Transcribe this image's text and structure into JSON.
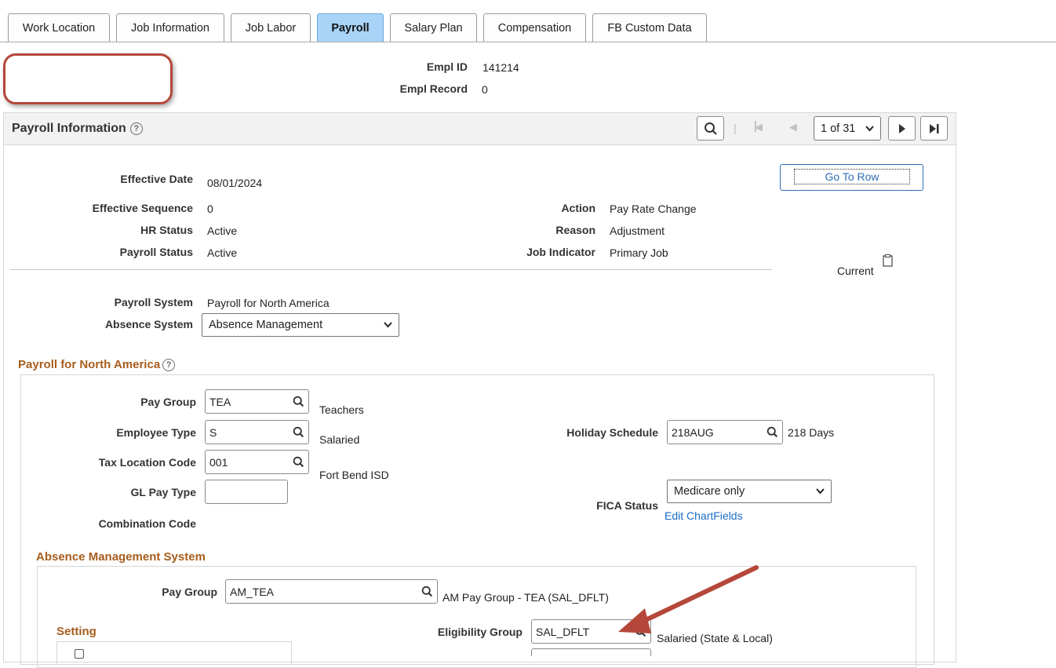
{
  "tabs": [
    {
      "label": "Work Location"
    },
    {
      "label": "Job Information"
    },
    {
      "label": "Job Labor"
    },
    {
      "label": "Payroll"
    },
    {
      "label": "Salary Plan"
    },
    {
      "label": "Compensation"
    },
    {
      "label": "FB Custom Data"
    }
  ],
  "active_tab": "Payroll",
  "employee": {
    "empl_id_label": "Empl ID",
    "empl_id": "141214",
    "empl_record_label": "Empl Record",
    "empl_record": "0"
  },
  "payroll_info": {
    "title": "Payroll Information",
    "pager": "1 of 31",
    "go_to_row": "Go To Row",
    "effective_date_label": "Effective Date",
    "effective_date": "08/01/2024",
    "effective_sequence_label": "Effective Sequence",
    "effective_sequence": "0",
    "hr_status_label": "HR Status",
    "hr_status": "Active",
    "payroll_status_label": "Payroll Status",
    "payroll_status": "Active",
    "action_label": "Action",
    "action": "Pay Rate Change",
    "reason_label": "Reason",
    "reason": "Adjustment",
    "job_indicator_label": "Job Indicator",
    "job_indicator": "Primary Job",
    "current_label": "Current",
    "payroll_system_label": "Payroll System",
    "payroll_system": "Payroll for North America",
    "absence_system_label": "Absence System",
    "absence_system": "Absence Management"
  },
  "pna": {
    "title": "Payroll for North America",
    "pay_group_label": "Pay Group",
    "pay_group": "TEA",
    "pay_group_desc": "Teachers",
    "employee_type_label": "Employee Type",
    "employee_type": "S",
    "employee_type_desc": "Salaried",
    "tax_location_label": "Tax Location Code",
    "tax_location": "001",
    "tax_location_desc": "Fort Bend ISD",
    "gl_pay_type_label": "GL Pay Type",
    "gl_pay_type": "",
    "combination_code_label": "Combination Code",
    "holiday_schedule_label": "Holiday Schedule",
    "holiday_schedule": "218AUG",
    "holiday_schedule_desc": "218 Days",
    "fica_status_label": "FICA Status",
    "fica_status": "Medicare only",
    "edit_chartfields": "Edit ChartFields"
  },
  "ams": {
    "title": "Absence Management System",
    "pay_group_label": "Pay Group",
    "pay_group": "AM_TEA",
    "pay_group_desc": "AM Pay Group - TEA (SAL_DFLT)",
    "setting_title": "Setting",
    "eligibility_group_label": "Eligibility Group",
    "eligibility_group": "SAL_DFLT",
    "eligibility_group_desc": "Salaried (State & Local)"
  },
  "colors": {
    "accent_tab": "#a9d4f8",
    "section_title": "#a65d1d",
    "annotation": "#b5473a",
    "link": "#1a6cc4"
  }
}
